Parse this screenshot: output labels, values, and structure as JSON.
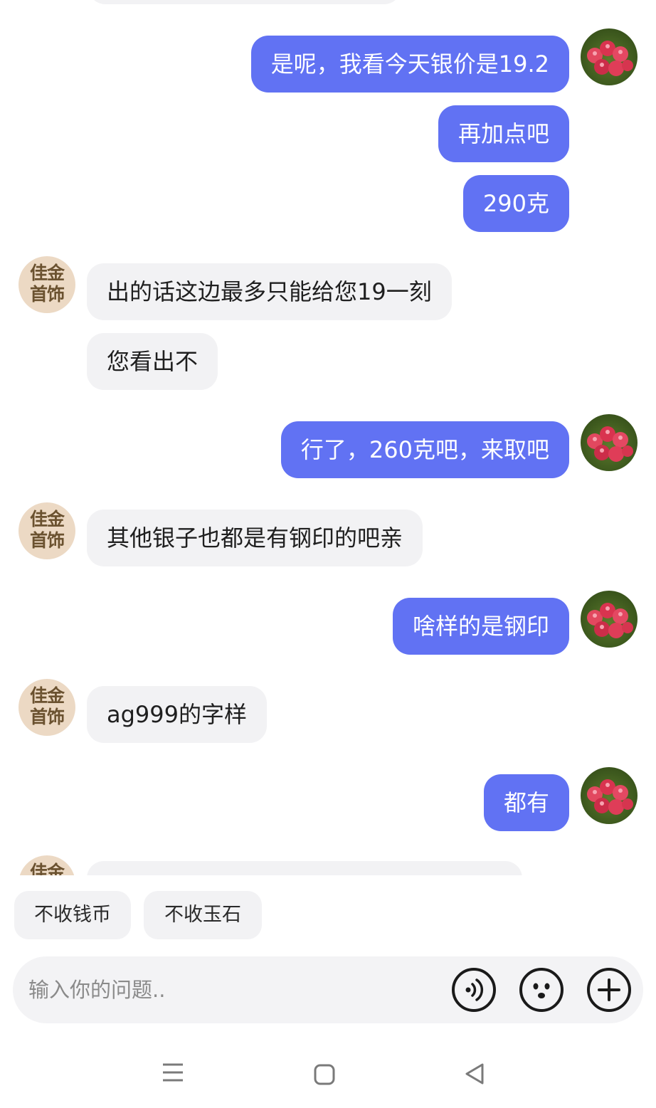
{
  "messages": [
    {
      "from": "me",
      "text": "是呢，我看今天银价是19.2"
    },
    {
      "from": "me",
      "text": "再加点吧"
    },
    {
      "from": "me",
      "text": "290克"
    },
    {
      "from": "shop",
      "text": "出的话这边最多只能给您19一刻"
    },
    {
      "from": "shop",
      "text": "您看出不"
    },
    {
      "from": "me",
      "text": "行了，260克吧，来取吧"
    },
    {
      "from": "shop",
      "text": "其他银子也都是有钢印的吧亲"
    },
    {
      "from": "me",
      "text": "啥样的是钢印"
    },
    {
      "from": "shop",
      "text": "ag999的字样"
    },
    {
      "from": "me",
      "text": "都有"
    }
  ],
  "shop_avatar": {
    "line1": "佳金",
    "line2": "首饰"
  },
  "suggestions": [
    "不收钱币",
    "不收玉石"
  ],
  "input": {
    "placeholder": "输入你的问题.."
  },
  "icons": {
    "voice": "voice-icon",
    "emoji": "emoji-icon",
    "add": "plus-icon",
    "nav_menu": "menu-icon",
    "nav_home": "home-icon",
    "nav_back": "back-icon"
  },
  "colors": {
    "outgoing_bubble": "#6172f3",
    "incoming_bubble": "#f2f2f4"
  }
}
